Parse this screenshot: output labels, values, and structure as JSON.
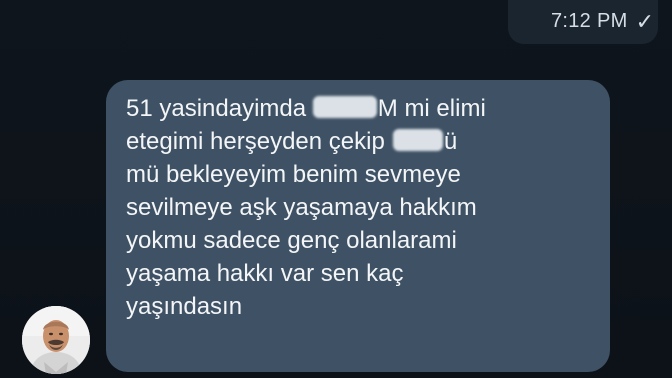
{
  "header": {
    "time": "7:12 PM",
    "read_icon": "check-icon"
  },
  "message": {
    "lines": [
      {
        "before": "51 yasindayimda ",
        "after": "M mi elimi"
      },
      {
        "before": "etegimi herşeyden çekip",
        "after": "ü"
      },
      {
        "text": "mü bekleyeyim benim sevmeye"
      },
      {
        "text": "sevilmeye aşk yaşamaya hakkım"
      },
      {
        "text": "yokmu sadece genç olanlarami"
      },
      {
        "text": "yaşama hakkı var sen kaç"
      },
      {
        "text": "yaşındasın"
      }
    ]
  },
  "colors": {
    "background": "#0c1117",
    "bubble": "#3f5265",
    "text": "#f3f5f7"
  },
  "avatar": {
    "icon": "person-avatar"
  }
}
